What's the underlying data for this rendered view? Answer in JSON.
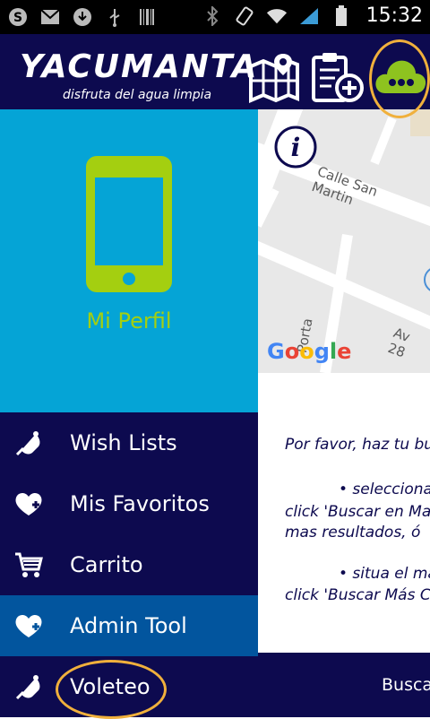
{
  "status_bar": {
    "time": "15:32",
    "left_icons": [
      "skype-icon",
      "gmail-icon",
      "download-icon",
      "usb-icon",
      "barcode-icon"
    ],
    "right_icons": [
      "bluetooth-icon",
      "rotate-icon",
      "wifi-icon",
      "signal-icon",
      "battery-icon"
    ]
  },
  "header": {
    "logo_title": "YACUMANTA",
    "logo_subtitle": "disfruta del agua limpia",
    "icons": [
      "map-icon",
      "clipboard-add-icon",
      "cloud-more-icon"
    ]
  },
  "drawer": {
    "profile_label": "Mi Perfil",
    "items": [
      {
        "label": "Wish Lists",
        "icon": "bell-icon"
      },
      {
        "label": "Mis Favoritos",
        "icon": "heart-plus-icon"
      },
      {
        "label": "Carrito",
        "icon": "cart-icon"
      },
      {
        "label": "Admin Tool",
        "icon": "heart-plus-icon"
      },
      {
        "label": "Voleteo",
        "icon": "bell-icon"
      }
    ]
  },
  "map": {
    "streets": [
      "Calle San Martin",
      "Av 28",
      "Porta"
    ],
    "google_logo": "Google"
  },
  "instructions": {
    "lines": [
      "Por favor, haz tu bu",
      "• selecciona",
      "click 'Buscar en Ma",
      "mas resultados, ó",
      "• situa el ma",
      "click 'Buscar Más C"
    ]
  },
  "bottom_bar": {
    "label": "Busca"
  },
  "colors": {
    "navy": "#0d0a4f",
    "cyan": "#05a4d6",
    "lime": "#a4cf10",
    "active_blue": "#02559e",
    "highlight_orange": "#f0b03c"
  }
}
